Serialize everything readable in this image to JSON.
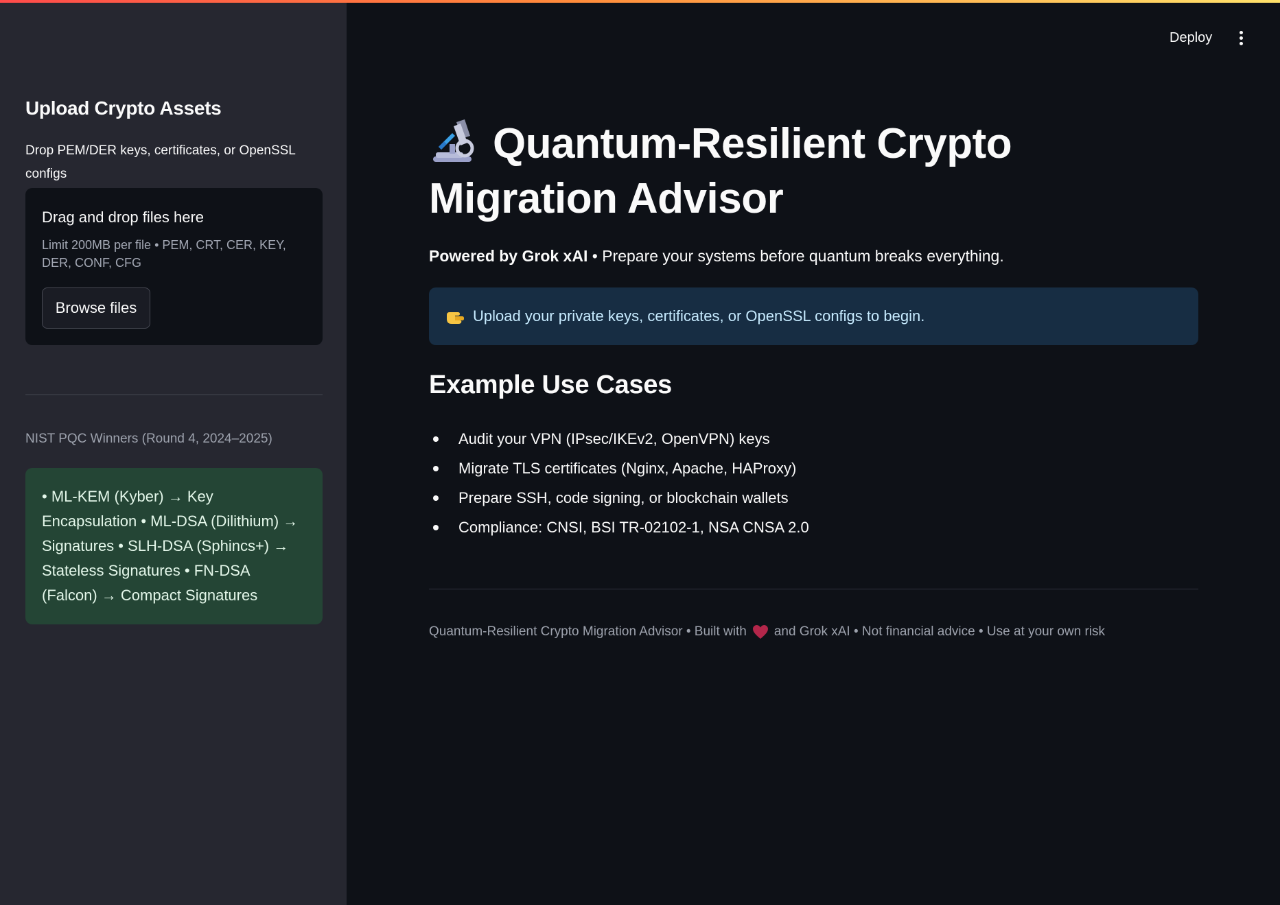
{
  "header": {
    "deploy_label": "Deploy",
    "menu_icon": "vertical-ellipsis-icon"
  },
  "sidebar": {
    "heading": "Upload Crypto Assets",
    "caption": "Drop PEM/DER keys, certificates, or OpenSSL configs",
    "uploader": {
      "title": "Drag and drop files here",
      "limit": "Limit 200MB per file • PEM, CRT, CER, KEY, DER, CONF, CFG",
      "browse_label": "Browse files"
    },
    "nist_caption": "NIST PQC Winners (Round 4, 2024–2025)",
    "nist_text": "• ML-KEM (Kyber) → Key Encapsulation • ML-DSA (Dilithium) → Signatures • SLH-DSA (Sphincs+) → Stateless Signatures • FN-DSA (Falcon) → Compact Signatures"
  },
  "main": {
    "title_icon": "microscope-icon",
    "title": "Quantum-Resilient Crypto Migration Advisor",
    "powered_bold": "Powered by Grok xAI",
    "powered_rest": " • Prepare your systems before quantum breaks everything.",
    "info_icon": "pointing-hand-icon",
    "info_text": "Upload your private keys, certificates, or OpenSSL configs to begin.",
    "use_cases_heading": "Example Use Cases",
    "use_cases": [
      "Audit your VPN (IPsec/IKEv2, OpenVPN) keys",
      "Migrate TLS certificates (Nginx, Apache, HAProxy)",
      "Prepare SSH, code signing, or blockchain wallets",
      "Compliance: CNSI, BSI TR-02102-1, NSA CNSA 2.0"
    ],
    "footer_before": "Quantum-Resilient Crypto Migration Advisor • Built with",
    "footer_icon": "heart-icon",
    "footer_after": "and Grok xAI • Not financial advice • Use at your own risk"
  },
  "colors": {
    "background": "#0e1117",
    "sidebar": "#262730",
    "info_box": "#172d43",
    "success_box": "#244535",
    "accent_gradient_start": "#ff4b4b",
    "accent_gradient_end": "#ffe26b"
  }
}
